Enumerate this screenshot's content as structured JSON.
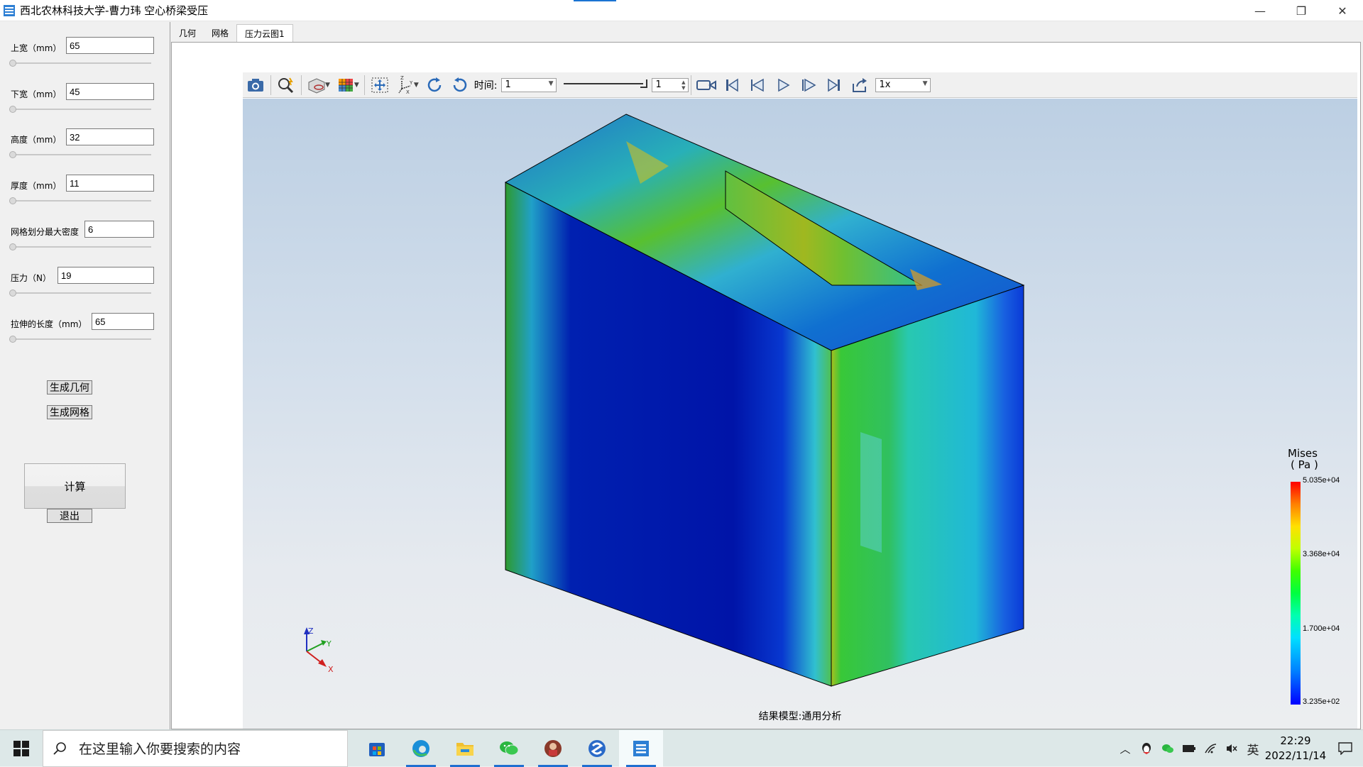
{
  "window": {
    "title": "西北农林科技大学-曹力玮 空心桥梁受压",
    "minimize": "—",
    "maximize": "❐",
    "close": "✕"
  },
  "params": [
    {
      "label": "上宽（mm）",
      "value": "65"
    },
    {
      "label": "下宽（mm）",
      "value": "45"
    },
    {
      "label": "高度（mm）",
      "value": "32"
    },
    {
      "label": "厚度（mm）",
      "value": "11"
    },
    {
      "label": "网格划分最大密度",
      "value": "6"
    },
    {
      "label": "压力（N）",
      "value": "19"
    },
    {
      "label": "拉伸的长度（mm）",
      "value": "65"
    }
  ],
  "buttons": {
    "gen_geometry": "生成几何",
    "gen_mesh": "生成网格",
    "compute": "计算",
    "exit": "退出"
  },
  "tabs": [
    "几何",
    "网格",
    "压力云图1"
  ],
  "toolbar": {
    "time_label": "时间:",
    "time_value": "1",
    "frame_value": "1",
    "speed_value": "1x"
  },
  "viewport": {
    "footer": "结果模型:通用分析",
    "axes": {
      "z": "Z",
      "y": "Y",
      "x": "X"
    }
  },
  "legend": {
    "title_line1": "Mises",
    "title_line2": "( Pa )",
    "max": "5.035e+04",
    "mid_high": "3.368e+04",
    "mid_low": "1.700e+04",
    "min": "3.235e+02"
  },
  "taskbar": {
    "search_placeholder": "在这里输入你要搜索的内容",
    "ime": "英",
    "time": "22:29",
    "date": "2022/11/14"
  },
  "colors": {
    "accent": "#1a73d2",
    "stress_high": "#ff0000",
    "stress_low": "#0000c8"
  }
}
